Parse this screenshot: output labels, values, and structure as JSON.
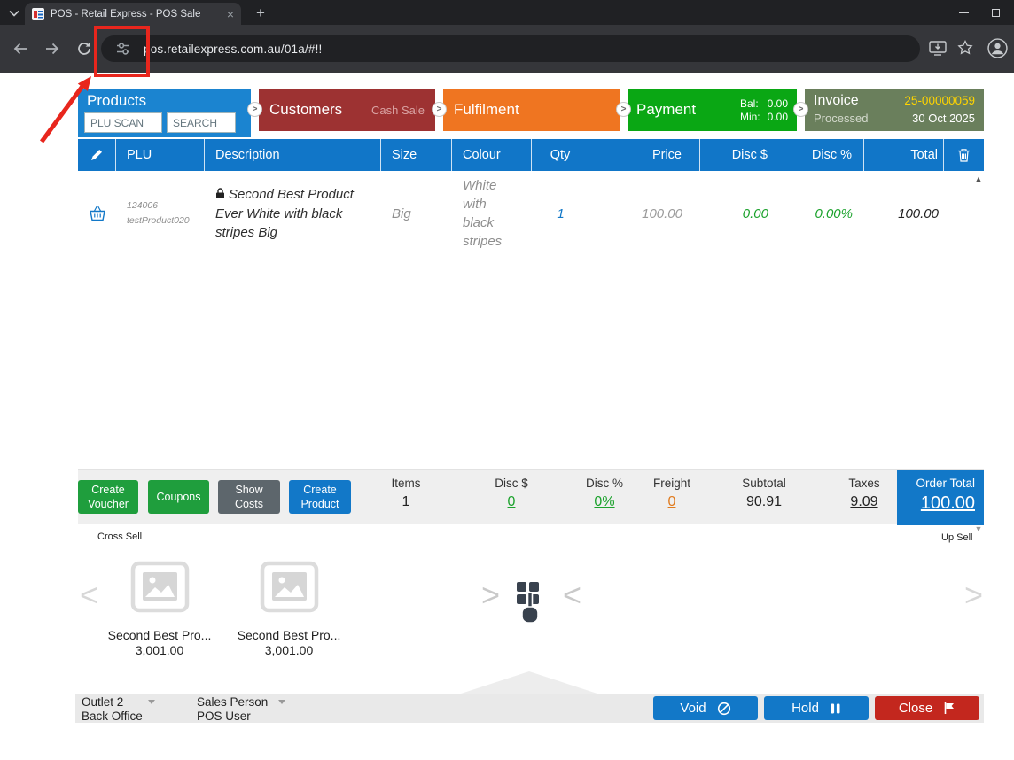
{
  "colors": {
    "brand_blue": "#1278c8",
    "customers_red": "#9d3232",
    "fulfilment_orange": "#ef7521",
    "payment_green": "#0aa714",
    "invoice_sage": "#6a7f5c",
    "invoice_number_yellow": "#ffd400",
    "action_green": "#1f9e3d",
    "close_red": "#c3271e",
    "value_green": "#1ba22c",
    "freight_orange": "#e07b1f",
    "annotation_red": "#e8261d"
  },
  "glyphs": {
    "step_chevron": ">",
    "tab_close": "×",
    "new_tab": "+",
    "scroll_up": "▲",
    "scroll_down": "▼",
    "chevron_left": "<",
    "chevron_right": ">"
  },
  "browser": {
    "tab_title": "POS - Retail Express - POS Sale",
    "url": "pos.retailexpress.com.au/01a/#!!"
  },
  "steps": {
    "products": {
      "title": "Products",
      "plu_scan": "PLU SCAN",
      "search": "SEARCH"
    },
    "customers": {
      "title": "Customers",
      "customer_name": "Cash Sale"
    },
    "fulfilment": {
      "title": "Fulfilment"
    },
    "payment": {
      "title": "Payment",
      "bal_label": "Bal:",
      "bal_value": "0.00",
      "min_label": "Min:",
      "min_value": "0.00"
    },
    "invoice": {
      "title": "Invoice",
      "number": "25-00000059",
      "status": "Processed",
      "date": "30 Oct 2025"
    }
  },
  "table": {
    "headers": [
      "PLU",
      "Description",
      "Size",
      "Colour",
      "Qty",
      "Price",
      "Disc $",
      "Disc %",
      "Total"
    ],
    "rows": [
      {
        "plu_code": "124006",
        "plu_name": "testProduct020",
        "description": "Second Best Product Ever White with black stripes Big",
        "size": "Big",
        "colour": "White with black stripes",
        "qty": "1",
        "price": "100.00",
        "disc_dollar": "0.00",
        "disc_percent": "0.00%",
        "total": "100.00"
      }
    ]
  },
  "summary": {
    "create_voucher": "Create Voucher",
    "coupons": "Coupons",
    "show_costs": "Show Costs",
    "create_product": "Create Product",
    "items_label": "Items",
    "items_value": "1",
    "disc_dollar_label": "Disc $",
    "disc_dollar_value": "0",
    "disc_percent_label": "Disc %",
    "disc_percent_value": "0%",
    "freight_label": "Freight",
    "freight_value": "0",
    "subtotal_label": "Subtotal",
    "subtotal_value": "90.91",
    "taxes_label": "Taxes",
    "taxes_value": "9.09",
    "order_total_label": "Order Total",
    "order_total_value": "100.00"
  },
  "sell": {
    "cross_sell_label": "Cross Sell",
    "up_sell_label": "Up Sell",
    "items": [
      {
        "name": "Second Best Pro...",
        "price": "3,001.00"
      },
      {
        "name": "Second Best Pro...",
        "price": "3,001.00"
      }
    ]
  },
  "footer": {
    "outlet_label": "Outlet 2",
    "outlet_value": "Back Office",
    "salesperson_label": "Sales Person",
    "salesperson_value": "POS User",
    "void_label": "Void",
    "hold_label": "Hold",
    "close_label": "Close"
  }
}
